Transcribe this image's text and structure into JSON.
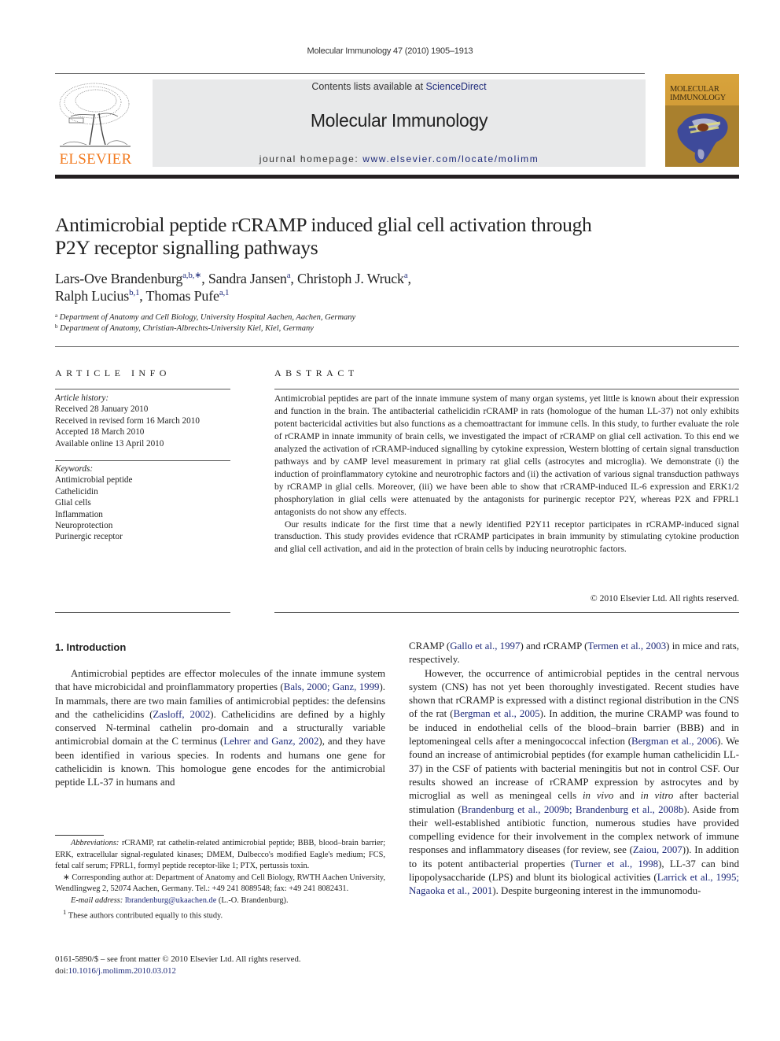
{
  "running_head": "Molecular Immunology 47 (2010) 1905–1913",
  "masthead": {
    "publisher_logo_text": "ELSEVIER",
    "contents_prefix": "Contents lists available at ",
    "contents_link": "ScienceDirect",
    "journal_name": "Molecular Immunology",
    "homepage_prefix": "journal homepage: ",
    "homepage_link": "www.elsevier.com/locate/molimm",
    "cover_title_line1": "MOLECULAR",
    "cover_title_line2": "IMMUNOLOGY",
    "colors": {
      "elsevier_orange": "#f27b21",
      "link_blue": "#1e2a7a",
      "band_gray": "#e8e9ea",
      "cover_gold": "#d8a33c"
    }
  },
  "article": {
    "title_line1": "Antimicrobial peptide rCRAMP induced glial cell activation through",
    "title_line2": "P2Y receptor signalling pathways",
    "authors": [
      {
        "name": "Lars-Ove Brandenburg",
        "marks": "a,b,∗",
        "sep": ", "
      },
      {
        "name": "Sandra Jansen",
        "marks": "a",
        "sep": ", "
      },
      {
        "name": "Christoph J. Wruck",
        "marks": "a",
        "sep": ","
      },
      {
        "name": "Ralph Lucius",
        "marks": "b,1",
        "sep": ", "
      },
      {
        "name": "Thomas Pufe",
        "marks": "a,1",
        "sep": ""
      }
    ],
    "affiliations": [
      {
        "mark": "a",
        "text": "Department of Anatomy and Cell Biology, University Hospital Aachen, Aachen, Germany"
      },
      {
        "mark": "b",
        "text": "Department of Anatomy, Christian-Albrechts-University Kiel, Kiel, Germany"
      }
    ]
  },
  "article_info": {
    "heading": "ARTICLE INFO",
    "history_label": "Article history:",
    "history": [
      "Received 28 January 2010",
      "Received in revised form 16 March 2010",
      "Accepted 18 March 2010",
      "Available online 13 April 2010"
    ],
    "keywords_label": "Keywords:",
    "keywords": [
      "Antimicrobial peptide",
      "Cathelicidin",
      "Glial cells",
      "Inflammation",
      "Neuroprotection",
      "Purinergic receptor"
    ]
  },
  "abstract": {
    "heading": "ABSTRACT",
    "paragraphs": [
      "Antimicrobial peptides are part of the innate immune system of many organ systems, yet little is known about their expression and function in the brain. The antibacterial cathelicidin rCRAMP in rats (homologue of the human LL-37) not only exhibits potent bactericidal activities but also functions as a chemoattractant for immune cells. In this study, to further evaluate the role of rCRAMP in innate immunity of brain cells, we investigated the impact of rCRAMP on glial cell activation. To this end we analyzed the activation of rCRAMP-induced signalling by cytokine expression, Western blotting of certain signal transduction pathways and by cAMP level measurement in primary rat glial cells (astrocytes and microglia). We demonstrate (i) the induction of proinflammatory cytokine and neurotrophic factors and (ii) the activation of various signal transduction pathways by rCRAMP in glial cells. Moreover, (iii) we have been able to show that rCRAMP-induced IL-6 expression and ERK1/2 phosphorylation in glial cells were attenuated by the antagonists for purinergic receptor P2Y, whereas P2X and FPRL1 antagonists do not show any effects.",
      "Our results indicate for the first time that a newly identified P2Y11 receptor participates in rCRAMP-induced signal transduction. This study provides evidence that rCRAMP participates in brain immunity by stimulating cytokine production and glial cell activation, and aid in the protection of brain cells by inducing neurotrophic factors."
    ],
    "copyright": "© 2010 Elsevier Ltd. All rights reserved."
  },
  "introduction": {
    "heading": "1.  Introduction",
    "left_p1": [
      {
        "t": "Antimicrobial peptides are effector molecules of the innate immune system that have microbicidal and proinflammatory properties ("
      },
      {
        "link": "Bals, 2000; Ganz, 1999"
      },
      {
        "t": "). In mammals, there are two main families of antimicrobial peptides: the defensins and the cathelicidins ("
      },
      {
        "link": "Zasloff, 2002"
      },
      {
        "t": "). Cathelicidins are defined by a highly conserved N-terminal cathelin pro-domain and a structurally variable antimicrobial domain at the C terminus ("
      },
      {
        "link": "Lehrer and Ganz, 2002"
      },
      {
        "t": "), and they have been identified in various species. In rodents and humans one gene for cathelicidin is known. This homologue gene encodes for the antimicrobial peptide LL-37 in humans and"
      }
    ],
    "right_p0": [
      {
        "t": "CRAMP ("
      },
      {
        "link": "Gallo et al., 1997"
      },
      {
        "t": ") and rCRAMP ("
      },
      {
        "link": "Termen et al., 2003"
      },
      {
        "t": ") in mice and rats, respectively."
      }
    ],
    "right_p1": [
      {
        "t": "However, the occurrence of antimicrobial peptides in the central nervous system (CNS) has not yet been thoroughly investigated. Recent studies have shown that rCRAMP is expressed with a distinct regional distribution in the CNS of the rat ("
      },
      {
        "link": "Bergman et al., 2005"
      },
      {
        "t": "). In addition, the murine CRAMP was found to be induced in endothelial cells of the blood–brain barrier (BBB) and in leptomeningeal cells after a meningococcal infection ("
      },
      {
        "link": "Bergman et al., 2006"
      },
      {
        "t": "). We found an increase of antimicrobial peptides (for example human cathelicidin LL-37) in the CSF of patients with bacterial meningitis but not in control CSF. Our results showed an increase of rCRAMP expression by astrocytes and by microglial as well as meningeal cells "
      },
      {
        "i": "in vivo"
      },
      {
        "t": " and "
      },
      {
        "i": "in vitro"
      },
      {
        "t": " after bacterial stimulation ("
      },
      {
        "link": "Brandenburg et al., 2009b; Brandenburg et al., 2008b"
      },
      {
        "t": "). Aside from their well-established antibiotic function, numerous studies have provided compelling evidence for their involvement in the complex network of immune responses and inflammatory diseases (for review, see ("
      },
      {
        "link": "Zaiou, 2007"
      },
      {
        "t": ")). In addition to its potent antibacterial properties ("
      },
      {
        "link": "Turner et al., 1998"
      },
      {
        "t": "), LL-37 can bind lipopolysaccharide (LPS) and blunt its biological activities ("
      },
      {
        "link": "Larrick et al., 1995; Nagaoka et al., 2001"
      },
      {
        "t": "). Despite burgeoning interest in the immunomodu-"
      }
    ]
  },
  "footnotes": {
    "abbrev_label": "Abbreviations:",
    "abbrev_text": "  rCRAMP, rat cathelin-related antimicrobial peptide; BBB, blood–brain barrier; ERK, extracellular signal-regulated kinases; DMEM, Dulbecco's modified Eagle's medium; FCS, fetal calf serum; FPRL1, formyl peptide receptor-like 1; PTX, pertussis toxin.",
    "corresponding": "∗ Corresponding author at: Department of Anatomy and Cell Biology, RWTH Aachen University, Wendlingweg 2, 52074 Aachen, Germany. Tel.: +49 241 8089548; fax: +49 241 8082431.",
    "email_label": "E-mail address:",
    "email": "lbrandenburg@ukaachen.de",
    "email_suffix": " (L.-O. Brandenburg).",
    "equal_mark": "1",
    "equal_text": " These authors contributed equally to this study."
  },
  "issn": {
    "line": "0161-5890/$ – see front matter © 2010 Elsevier Ltd. All rights reserved.",
    "doi_prefix": "doi:",
    "doi": "10.1016/j.molimm.2010.03.012"
  }
}
